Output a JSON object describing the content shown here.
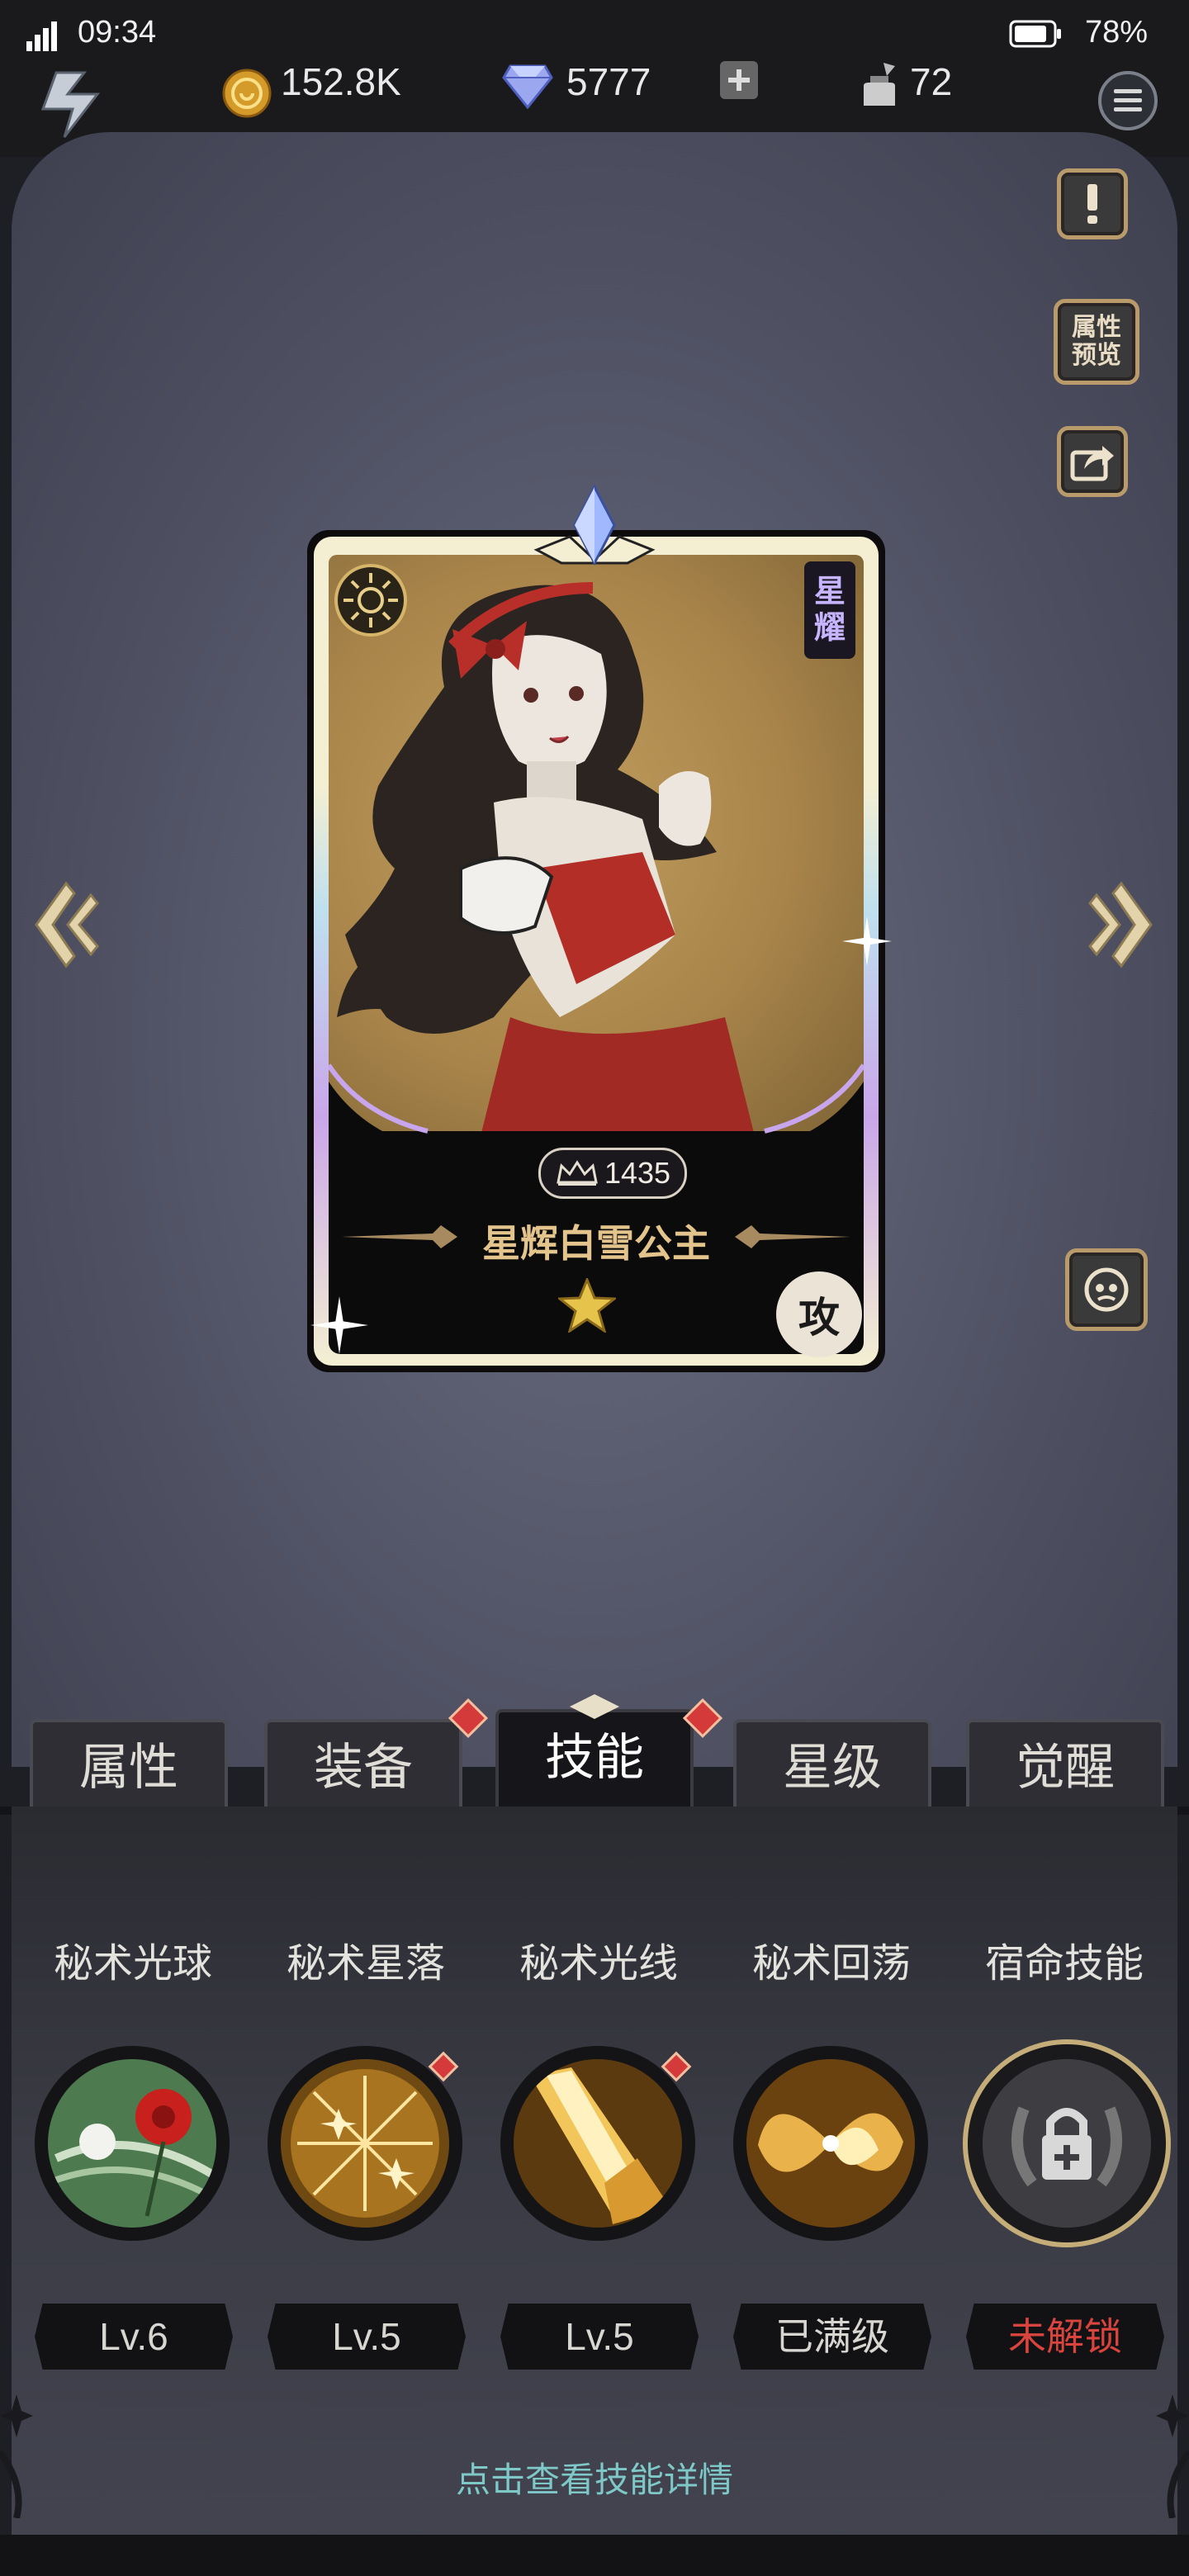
{
  "status_bar": {
    "time": "09:34",
    "battery": "78%"
  },
  "resources": {
    "gold": "152.8K",
    "diamonds": "5777",
    "stamina": "72"
  },
  "side_buttons": {
    "attribute_preview": "属性预览"
  },
  "card": {
    "rank_label": "星耀",
    "power": "1435",
    "name": "星辉白雪公主",
    "role": "攻"
  },
  "tabs": [
    "属性",
    "装备",
    "技能",
    "星级",
    "觉醒"
  ],
  "active_tab": "技能",
  "skills": [
    {
      "name": "秘术光球",
      "level": "Lv.6"
    },
    {
      "name": "秘术星落",
      "level": "Lv.5"
    },
    {
      "name": "秘术光线",
      "level": "Lv.5"
    },
    {
      "name": "秘术回荡",
      "level": "已满级"
    },
    {
      "name": "宿命技能",
      "level": "未解锁"
    }
  ],
  "hint": "点击查看技能详情",
  "colors": {
    "locked": "#d9453e",
    "hint": "#7ec8c8",
    "gold_frame": "#b99a6a"
  }
}
